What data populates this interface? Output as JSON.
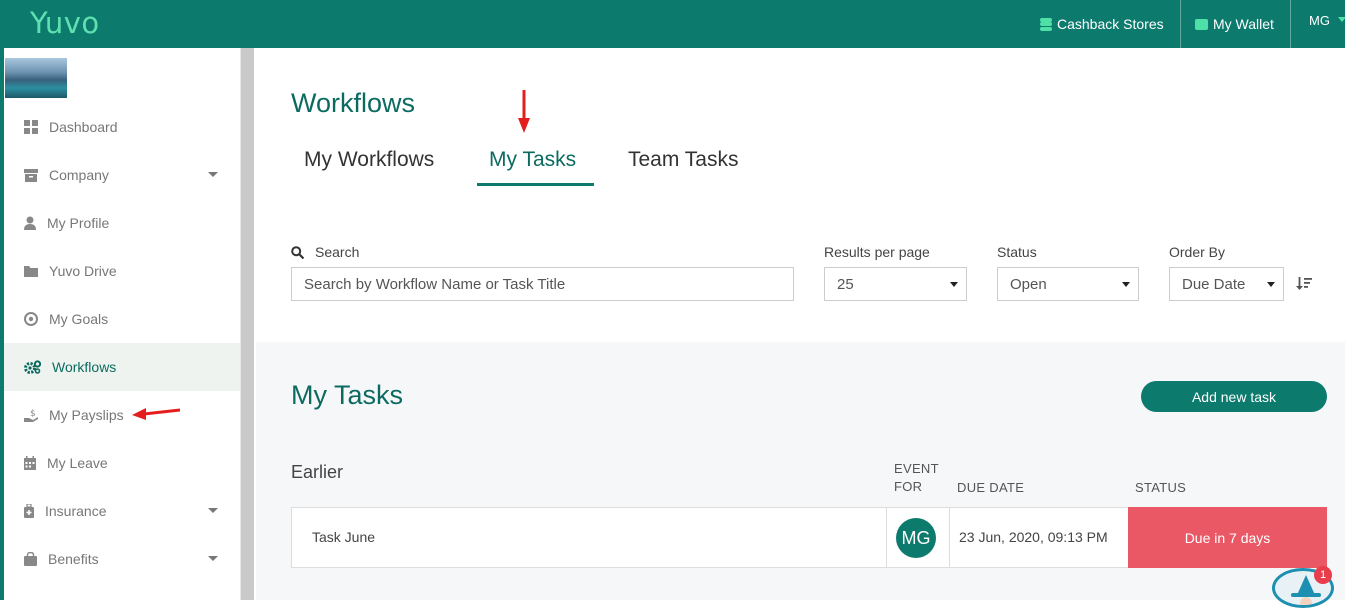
{
  "header": {
    "brand": "Yuvo",
    "cashback_label": "Cashback Stores",
    "wallet_label": "My Wallet",
    "user_initials": "MG",
    "brand_color": "#0c7a6d"
  },
  "sidebar": {
    "items": [
      {
        "label": "Dashboard",
        "icon": "grid-icon"
      },
      {
        "label": "Company",
        "icon": "archive-box-icon",
        "has_caret": true
      },
      {
        "label": "My Profile",
        "icon": "user-icon"
      },
      {
        "label": "Yuvo Drive",
        "icon": "folder-icon"
      },
      {
        "label": "My Goals",
        "icon": "target-icon"
      },
      {
        "label": "Workflows",
        "icon": "cogs-icon",
        "active": true
      },
      {
        "label": "My Payslips",
        "icon": "hand-dollar-icon"
      },
      {
        "label": "My Leave",
        "icon": "calendar-icon"
      },
      {
        "label": "Insurance",
        "icon": "medical-bag-icon",
        "has_caret": true
      },
      {
        "label": "Benefits",
        "icon": "shopping-bag-icon",
        "has_caret": true
      }
    ]
  },
  "main": {
    "title": "Workflows",
    "tabs": [
      {
        "label": "My Workflows"
      },
      {
        "label": "My Tasks",
        "active": true
      },
      {
        "label": "Team Tasks"
      }
    ],
    "filters": {
      "search_label": "Search",
      "search_placeholder": "Search by Workflow Name or Task Title",
      "results_label": "Results per page",
      "results_value": "25",
      "status_label": "Status",
      "status_value": "Open",
      "order_label": "Order By",
      "order_value": "Due Date"
    },
    "tasks": {
      "title": "My Tasks",
      "add_button": "Add new task",
      "group": "Earlier",
      "columns": {
        "event_for_line1": "EVENT",
        "event_for_line2": "FOR",
        "due_date": "DUE DATE",
        "status": "STATUS"
      },
      "rows": [
        {
          "title": "Task June",
          "assignee": "MG",
          "due": "23 Jun, 2020, 09:13 PM",
          "status": "Due in 7 days",
          "status_color": "#ea5866"
        }
      ]
    }
  },
  "notification_count": "1"
}
